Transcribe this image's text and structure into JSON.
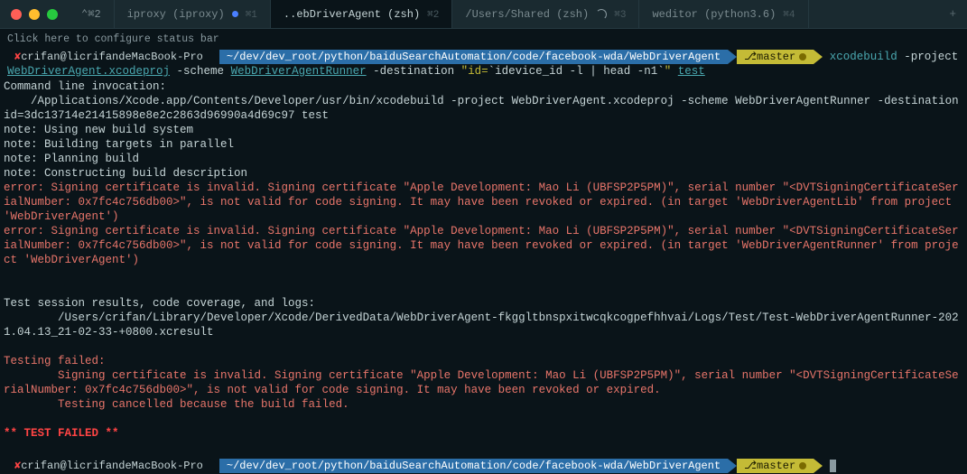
{
  "tabs": [
    {
      "label": "⌃⌘2",
      "key": ""
    },
    {
      "label": "iproxy (iproxy)",
      "key": "⌘1",
      "dot": true
    },
    {
      "label": "..ebDriverAgent (zsh)",
      "key": "⌘2",
      "active": true
    },
    {
      "label": "/Users/Shared (zsh)",
      "key": "⌘3",
      "spinner": true
    },
    {
      "label": "weditor (python3.6)",
      "key": "⌘4"
    }
  ],
  "statusbar": "Click here to configure status bar",
  "prompt": {
    "host": "crifan@licrifandeMacBook-Pro",
    "path": "~/dev/dev_root/python/baiduSearchAutomation/code/facebook-wda/WebDriverAgent",
    "branch_icon": "⎇",
    "branch": "master"
  },
  "cmd1": {
    "w1": "xcodebuild",
    "w2": "-project",
    "w3": "WebDriverAgent.xcodeproj",
    "w4": "-scheme",
    "w5": "WebDriverAgentRunner",
    "w6": "-destination",
    "w7": "\"id=",
    "w8": "`idevice_id -l | head -n1`",
    "w9": "\"",
    "w10": "test"
  },
  "output": {
    "l1": "Command line invocation:",
    "l2": "    /Applications/Xcode.app/Contents/Developer/usr/bin/xcodebuild -project WebDriverAgent.xcodeproj -scheme WebDriverAgentRunner -destination id=3dc13714e21415898e8e2c2863d96990a4d69c97 test",
    "l3": "",
    "l4": "note: Using new build system",
    "l5": "note: Building targets in parallel",
    "l6": "note: Planning build",
    "l7": "note: Constructing build description",
    "e1": "error: Signing certificate is invalid. Signing certificate \"Apple Development: Mao Li (UBFSP2P5PM)\", serial number \"<DVTSigningCertificateSerialNumber: 0x7fc4c756db00>\", is not valid for code signing. It may have been revoked or expired. (in target 'WebDriverAgentLib' from project 'WebDriverAgent')",
    "e2": "error: Signing certificate is invalid. Signing certificate \"Apple Development: Mao Li (UBFSP2P5PM)\", serial number \"<DVTSigningCertificateSerialNumber: 0x7fc4c756db00>\", is not valid for code signing. It may have been revoked or expired. (in target 'WebDriverAgentRunner' from project 'WebDriverAgent')",
    "l8": "",
    "l9": "",
    "l10": "Test session results, code coverage, and logs:",
    "l11": "        /Users/crifan/Library/Developer/Xcode/DerivedData/WebDriverAgent-fkggltbnspxitwcqkcogpefhhvai/Logs/Test/Test-WebDriverAgentRunner-2021.04.13_21-02-33-+0800.xcresult",
    "l12": "",
    "fail_head": "Testing failed:",
    "fail1": "        Signing certificate is invalid. Signing certificate \"Apple Development: Mao Li (UBFSP2P5PM)\", serial number \"<DVTSigningCertificateSerialNumber: 0x7fc4c756db00>\", is not valid for code signing. It may have been revoked or expired.",
    "fail2": "        Testing cancelled because the build failed.",
    "l13": "",
    "testfailed": "** TEST FAILED **",
    "l14": ""
  }
}
